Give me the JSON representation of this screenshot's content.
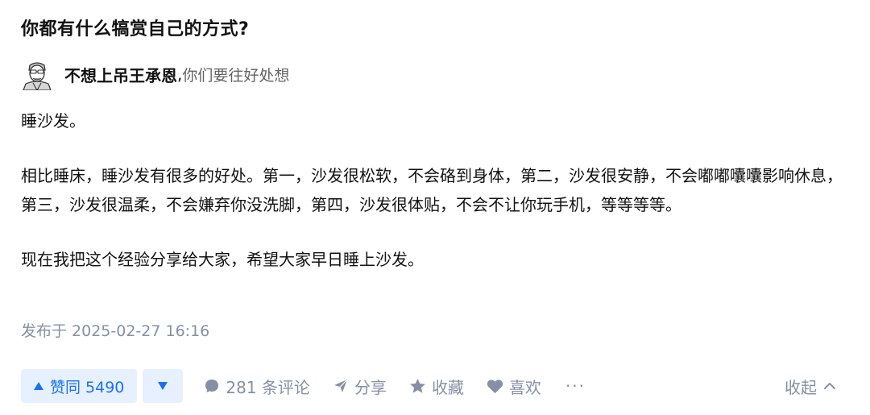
{
  "question": {
    "title": "你都有什么犒赏自己的方式?"
  },
  "author": {
    "name": "不想上吊王承恩",
    "separator": ",",
    "headline": "你们要往好处想"
  },
  "answer": {
    "paragraphs": [
      "睡沙发。",
      "相比睡床，睡沙发有很多的好处。第一，沙发很松软，不会硌到身体，第二，沙发很安静，不会嘟嘟囔囔影响休息，第三，沙发很温柔，不会嫌弃你没洗脚，第四，沙发很体贴，不会不让你玩手机，等等等等。",
      "现在我把这个经验分享给大家，希望大家早日睡上沙发。"
    ],
    "publish_time": "发布于 2025-02-27 16:16"
  },
  "actions": {
    "vote_up_label": "赞同 5490",
    "comments_label": "281 条评论",
    "share_label": "分享",
    "favorite_label": "收藏",
    "like_label": "喜欢",
    "more_label": "···",
    "collapse_label": "收起"
  },
  "colors": {
    "accent": "#1772f6",
    "accent_bg": "#e7f0ff",
    "meta": "#8590a6"
  }
}
